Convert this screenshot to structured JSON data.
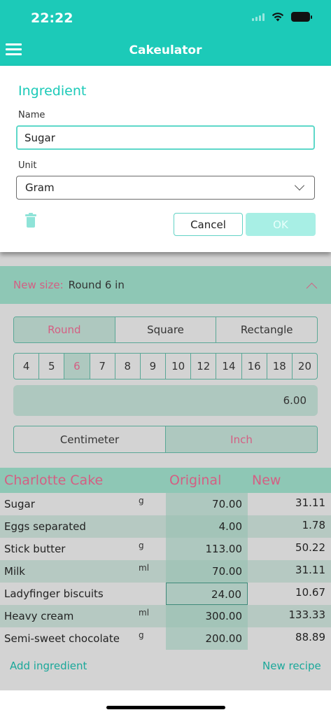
{
  "status": {
    "time": "22:22"
  },
  "header": {
    "title": "Cakeulator"
  },
  "dialog": {
    "title": "Ingredient",
    "name_label": "Name",
    "name_value": "Sugar",
    "unit_label": "Unit",
    "unit_value": "Gram",
    "cancel": "Cancel",
    "ok": "OK"
  },
  "size": {
    "label": "New size:",
    "value": "Round 6 in",
    "shapes": [
      "Round",
      "Square",
      "Rectangle"
    ],
    "selected_shape": "Round",
    "sizes": [
      "4",
      "5",
      "6",
      "7",
      "8",
      "9",
      "10",
      "12",
      "14",
      "16",
      "18",
      "20"
    ],
    "selected_size": "6",
    "value_field": "6.00",
    "units": [
      "Centimeter",
      "Inch"
    ],
    "selected_unit": "Inch"
  },
  "table": {
    "recipe": "Charlotte Cake",
    "col_original": "Original",
    "col_new": "New",
    "rows": [
      {
        "name": "Sugar",
        "unit": "g",
        "original": "70.00",
        "new": "31.11"
      },
      {
        "name": "Eggs separated",
        "unit": "",
        "original": "4.00",
        "new": "1.78"
      },
      {
        "name": "Stick butter",
        "unit": "g",
        "original": "113.00",
        "new": "50.22"
      },
      {
        "name": "Milk",
        "unit": "ml",
        "original": "70.00",
        "new": "31.11"
      },
      {
        "name": "Ladyfinger biscuits",
        "unit": "",
        "original": "24.00",
        "new": "10.67"
      },
      {
        "name": "Heavy cream",
        "unit": "ml",
        "original": "300.00",
        "new": "133.33"
      },
      {
        "name": "Semi-sweet chocolate",
        "unit": "g",
        "original": "200.00",
        "new": "88.89"
      }
    ]
  },
  "links": {
    "add": "Add ingredient",
    "new_recipe": "New recipe"
  },
  "colors": {
    "accent": "#1ccab8",
    "pink": "#d45f83",
    "selected": "#aec8bf",
    "bar": "#8ec7b5"
  }
}
